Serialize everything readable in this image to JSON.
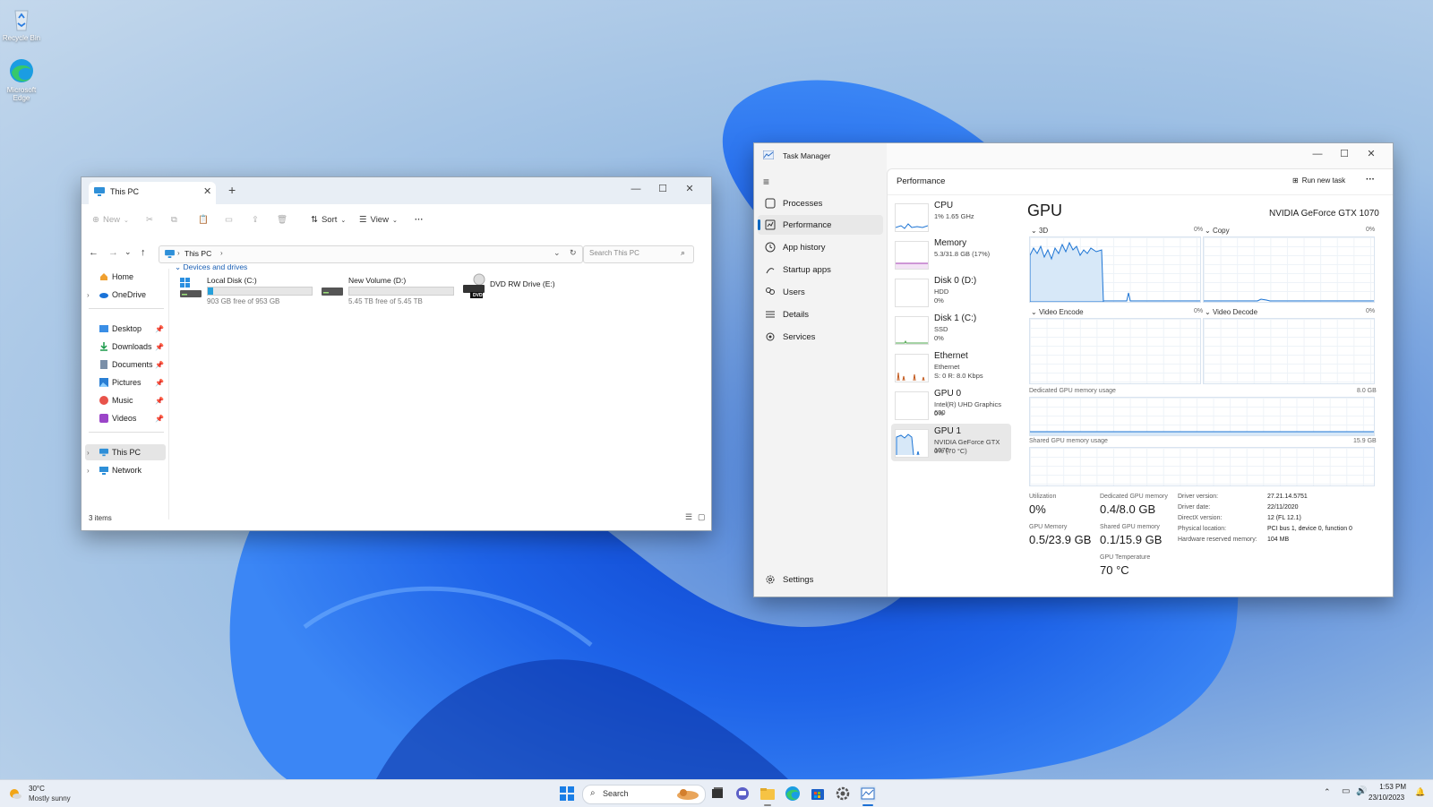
{
  "desktop": {
    "icons": [
      {
        "label": "Recycle Bin"
      },
      {
        "label": "Microsoft Edge"
      }
    ]
  },
  "explorer": {
    "tab_title": "This PC",
    "toolbar": {
      "new": "New",
      "sort": "Sort",
      "view": "View"
    },
    "breadcrumb": "This PC",
    "search_placeholder": "Search This PC",
    "nav": {
      "home": "Home",
      "onedrive": "OneDrive",
      "quick": [
        "Desktop",
        "Downloads",
        "Documents",
        "Pictures",
        "Music",
        "Videos"
      ],
      "this_pc": "This PC",
      "network": "Network"
    },
    "section": "Devices and drives",
    "drives": [
      {
        "name": "Local Disk (C:)",
        "free": "903 GB free of 953 GB",
        "used_fraction": 0.05
      },
      {
        "name": "New Volume (D:)",
        "free": "5.45 TB free of 5.45 TB",
        "used_fraction": 0.0
      },
      {
        "name": "DVD RW Drive (E:)",
        "badge": "DVD"
      }
    ],
    "status": "3 items"
  },
  "taskmgr": {
    "title": "Task Manager",
    "header": "Performance",
    "run_new_task": "Run new task",
    "nav": [
      "Processes",
      "Performance",
      "App history",
      "Startup apps",
      "Users",
      "Details",
      "Services"
    ],
    "settings": "Settings",
    "devices": [
      {
        "name": "CPU",
        "l2": "1% 1.65 GHz",
        "l3": ""
      },
      {
        "name": "Memory",
        "l2": "5.3/31.8 GB (17%)",
        "l3": ""
      },
      {
        "name": "Disk 0 (D:)",
        "l2": "HDD",
        "l3": "0%"
      },
      {
        "name": "Disk 1 (C:)",
        "l2": "SSD",
        "l3": "0%"
      },
      {
        "name": "Ethernet",
        "l2": "Ethernet",
        "l3": "S: 0 R: 8.0 Kbps"
      },
      {
        "name": "GPU 0",
        "l2": "Intel(R) UHD Graphics 630",
        "l3": "0%"
      },
      {
        "name": "GPU 1",
        "l2": "NVIDIA GeForce GTX 1070",
        "l3": "0% (70 °C)"
      }
    ],
    "gpu": {
      "title": "GPU",
      "model": "NVIDIA GeForce GTX 1070",
      "engines": [
        {
          "name": "3D",
          "pct": "0%"
        },
        {
          "name": "Copy",
          "pct": "0%"
        },
        {
          "name": "Video Encode",
          "pct": "0%"
        },
        {
          "name": "Video Decode",
          "pct": "0%"
        }
      ],
      "dedicated_label": "Dedicated GPU memory usage",
      "dedicated_max": "8.0 GB",
      "shared_label": "Shared GPU memory usage",
      "shared_max": "15.9 GB",
      "stats": {
        "utilization_label": "Utilization",
        "utilization": "0%",
        "dedicated_label": "Dedicated GPU memory",
        "dedicated": "0.4/8.0 GB",
        "gpu_memory_label": "GPU Memory",
        "gpu_memory": "0.5/23.9 GB",
        "shared_label": "Shared GPU memory",
        "shared": "0.1/15.9 GB",
        "temp_label": "GPU Temperature",
        "temp": "70 °C"
      },
      "details": [
        {
          "label": "Driver version:",
          "value": "27.21.14.5751"
        },
        {
          "label": "Driver date:",
          "value": "22/11/2020"
        },
        {
          "label": "DirectX version:",
          "value": "12 (FL 12.1)"
        },
        {
          "label": "Physical location:",
          "value": "PCI bus 1, device 0, function 0"
        },
        {
          "label": "Hardware reserved memory:",
          "value": "104 MB"
        }
      ]
    }
  },
  "taskbar": {
    "weather_temp": "30°C",
    "weather_desc": "Mostly sunny",
    "search": "Search",
    "time": "1:53 PM",
    "date": "23/10/2023"
  }
}
